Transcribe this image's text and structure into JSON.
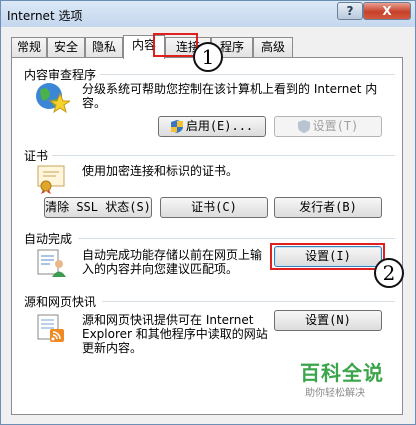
{
  "window": {
    "title": "Internet 选项"
  },
  "titlebar": {
    "help_glyph": "?",
    "close_glyph": "X"
  },
  "tabs": [
    {
      "label": "常规"
    },
    {
      "label": "安全"
    },
    {
      "label": "隐私"
    },
    {
      "label": "内容",
      "active": true
    },
    {
      "label": "连接"
    },
    {
      "label": "程序"
    },
    {
      "label": "高级"
    }
  ],
  "content_advisor": {
    "title": "内容审查程序",
    "description_line1": "分级系统可帮助您控制在该计算机上看到的 Internet 内",
    "description_line2": "容。",
    "enable_button": "启用(E)...",
    "settings_button": "设置(T)"
  },
  "certificates": {
    "title": "证书",
    "description": "使用加密连接和标识的证书。",
    "clear_ssl_button": "清除 SSL 状态(S)",
    "certificates_button": "证书(C)",
    "publishers_button": "发行者(B)"
  },
  "autocomplete": {
    "title": "自动完成",
    "description_line1": "自动完成功能存储以前在网页上输",
    "description_line2": "入的内容并向您建议匹配项。",
    "settings_button": "设置(I)"
  },
  "feeds": {
    "title": "源和网页快讯",
    "description_line1": "源和网页快讯提供可在 Internet",
    "description_line2": "Explorer 和其他程序中读取的网站",
    "description_line3": "更新内容。",
    "settings_button": "设置(N)"
  },
  "callouts": {
    "step1": "1",
    "step2": "2"
  },
  "watermark": {
    "main": "百科全说",
    "sub": "助你轻松解决"
  },
  "colors": {
    "annotation": "#e02020",
    "watermark": "#3aa54a",
    "close": "#c7412b"
  }
}
